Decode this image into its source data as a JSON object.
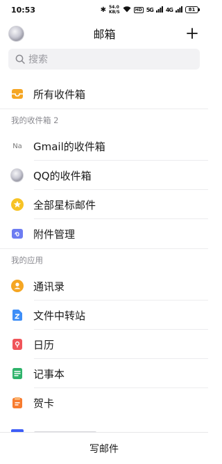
{
  "status_bar": {
    "time": "10:53",
    "net_speed_value": "54.0",
    "net_speed_unit": "KB/S",
    "hd_badge": "HD",
    "signal_1": "5G",
    "signal_2": "4G",
    "battery": "81"
  },
  "header": {
    "title": "邮箱",
    "add_symbol": "+"
  },
  "search": {
    "placeholder": "搜索"
  },
  "all_inbox": {
    "label": "所有收件箱",
    "icon_color": "#f5a623"
  },
  "my_inboxes": {
    "section_title": "我的收件箱 2",
    "items": [
      {
        "label": "Gmail的收件箱",
        "icon": "Na"
      },
      {
        "label": "QQ的收件箱",
        "icon": "qq-avatar"
      }
    ]
  },
  "utilities": {
    "items": [
      {
        "label": "全部星标邮件",
        "icon": "star-icon",
        "color": "#f7c325"
      },
      {
        "label": "附件管理",
        "icon": "attachment-icon",
        "color": "#6d7cf2"
      }
    ]
  },
  "my_apps": {
    "section_title": "我的应用",
    "items": [
      {
        "label": "通讯录",
        "icon": "contacts-icon",
        "color": "#f5a623"
      },
      {
        "label": "文件中转站",
        "icon": "file-transfer-icon",
        "color": "#3e8ef7"
      },
      {
        "label": "日历",
        "icon": "calendar-icon",
        "color": "#f0555a"
      },
      {
        "label": "记事本",
        "icon": "notepad-icon",
        "color": "#2fb36b"
      },
      {
        "label": "贺卡",
        "icon": "greeting-card-icon",
        "color": "#f77b2f"
      }
    ]
  },
  "bottom": {
    "compose_label": "写邮件"
  }
}
